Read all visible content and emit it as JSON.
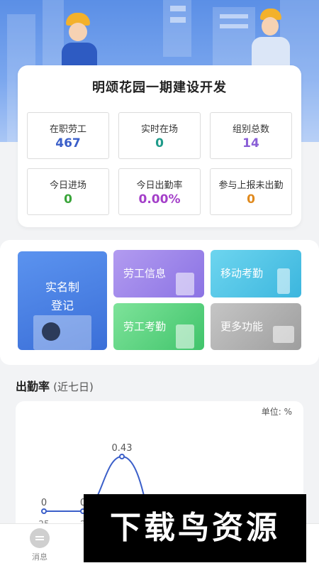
{
  "project": {
    "title": "明颂花园一期建设开发",
    "stats": [
      {
        "label": "在职劳工",
        "value": "467",
        "color": "#3b5fc9"
      },
      {
        "label": "实时在场",
        "value": "0",
        "color": "#1f9b8a"
      },
      {
        "label": "组别总数",
        "value": "14",
        "color": "#8a5fd6"
      },
      {
        "label": "今日进场",
        "value": "0",
        "color": "#3aa53a"
      },
      {
        "label": "今日出勤率",
        "value": "0.00%",
        "color": "#a43fc9"
      },
      {
        "label": "参与上报未出勤",
        "value": "0",
        "color": "#e08a1e"
      }
    ]
  },
  "menu": {
    "real_name": {
      "line1": "实名制",
      "line2": "登记"
    },
    "labor_info": "劳工信息",
    "mobile_attendance": "移动考勤",
    "labor_attendance": "劳工考勤",
    "more": "更多功能"
  },
  "attendance_section": {
    "title": "出勤率",
    "subtitle": "(近七日)",
    "unit": "单位: %"
  },
  "chart_data": {
    "type": "line",
    "x": [
      "25",
      "2"
    ],
    "values": [
      0,
      0,
      0.43
    ],
    "point_labels": [
      "0",
      "0",
      "0.43"
    ],
    "line_color": "#3b5fc9"
  },
  "watermark": "下载鸟资源",
  "tabbar": {
    "items": [
      {
        "label": "消息",
        "icon": "message-icon"
      }
    ]
  }
}
